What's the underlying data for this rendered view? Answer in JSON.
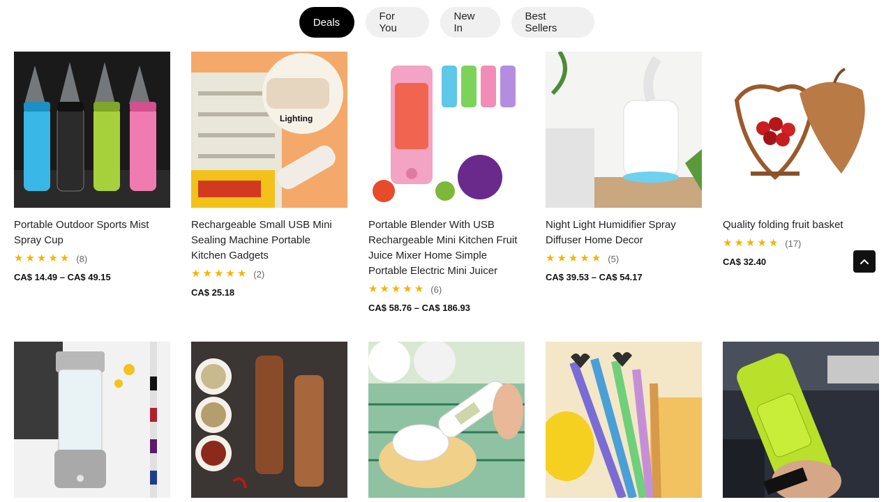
{
  "tabs": [
    {
      "label": "Deals",
      "active": true
    },
    {
      "label": "For You",
      "active": false
    },
    {
      "label": "New In",
      "active": false
    },
    {
      "label": "Best Sellers",
      "active": false
    }
  ],
  "products": [
    {
      "title": "Portable Outdoor Sports Mist Spray Cup",
      "rating": 5,
      "reviews": "(8)",
      "price": "CA$ 14.49 – CA$ 49.15",
      "image": "mist-spray-bottles-image"
    },
    {
      "title": "Rechargeable Small USB Mini Sealing Machine Portable Kitchen Gadgets",
      "rating": 5,
      "reviews": "(2)",
      "price": "CA$ 25.18",
      "image": "bag-sealer-image",
      "image_text": "Lighting"
    },
    {
      "title": "Portable Blender With USB Rechargeable Mini Kitchen Fruit Juice Mixer Home Simple Portable Electric Mini Juicer",
      "rating": 5,
      "reviews": "(6)",
      "price": "CA$ 58.76 – CA$ 186.93",
      "image": "portable-blender-image"
    },
    {
      "title": "Night Light Humidifier Spray Diffuser Home Decor",
      "rating": 5,
      "reviews": "(5)",
      "price": "CA$ 39.53 – CA$ 54.17",
      "image": "humidifier-image"
    },
    {
      "title": "Quality folding fruit basket",
      "rating": 5,
      "reviews": "(17)",
      "price": "CA$ 32.40",
      "image": "fruit-basket-image"
    },
    {
      "image": "hydrogen-water-bottle-image"
    },
    {
      "image": "pepper-mills-image"
    },
    {
      "image": "scale-spoon-image"
    },
    {
      "image": "heart-straws-image"
    },
    {
      "image": "sports-bottle-image"
    }
  ],
  "colors": {
    "star": "#f5b301",
    "active_tab": "#000000",
    "tab_bg": "#f0f0f0"
  },
  "back_to_top_icon": "chevron-up-icon"
}
